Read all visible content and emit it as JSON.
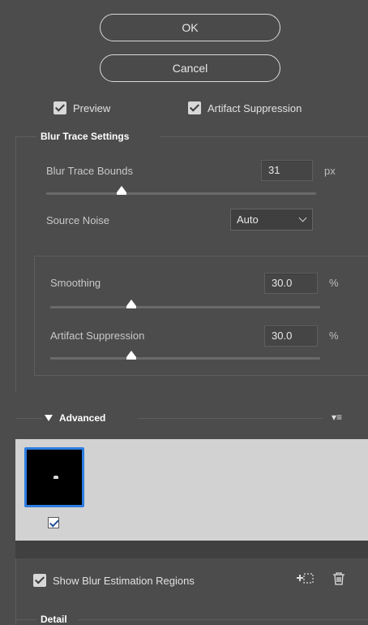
{
  "buttons": {
    "ok_label": "OK",
    "cancel_label": "Cancel"
  },
  "options": {
    "preview_label": "Preview",
    "artifact_suppression_label": "Artifact Suppression"
  },
  "blur_trace": {
    "section_title": "Blur Trace Settings",
    "bounds_label": "Blur Trace Bounds",
    "bounds_value": "31",
    "bounds_unit": "px",
    "bounds_slider_fraction": 0.28,
    "source_noise_label": "Source Noise",
    "source_noise_selected": "Auto",
    "smoothing_label": "Smoothing",
    "smoothing_value": "30.0",
    "smoothing_unit": "%",
    "smoothing_slider_fraction": 0.3,
    "artifact_label": "Artifact Suppression",
    "artifact_value": "30.0",
    "artifact_unit": "%",
    "artifact_slider_fraction": 0.3
  },
  "advanced": {
    "section_title": "Advanced",
    "expand_icon": "triangle-down-icon",
    "menu_icon": "panel-menu-icon",
    "show_regions_label": "Show Blur Estimation Regions",
    "add_region_icon": "add-region-icon",
    "delete_icon": "trash-icon"
  },
  "detail": {
    "section_title": "Detail"
  },
  "colors": {
    "background": "#4c4c4c",
    "accent": "#2d7de0",
    "panel_light": "#d2d2d2"
  }
}
